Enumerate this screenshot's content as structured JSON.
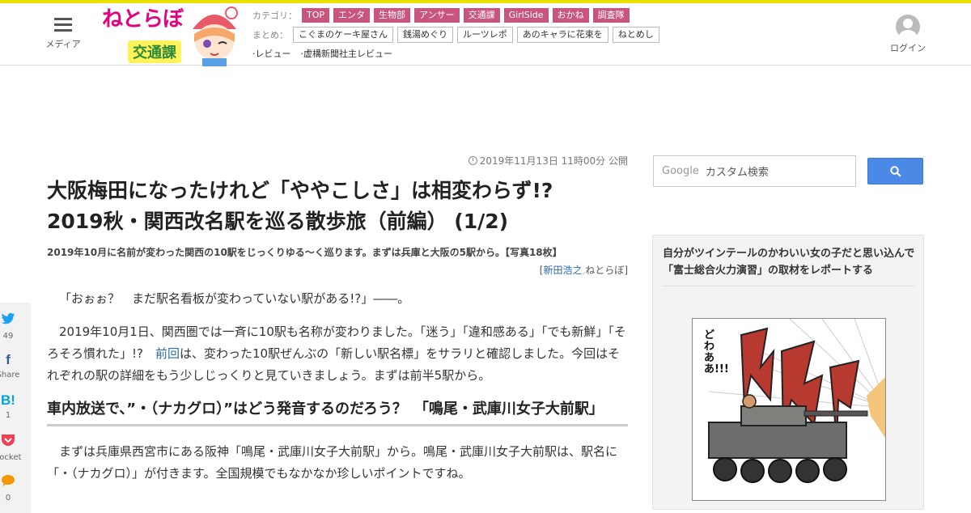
{
  "header": {
    "menu_label": "メディア",
    "logo_title": "ねとらぼ",
    "logo_subtitle": "交通課",
    "category_label": "カテゴリ：",
    "categories": [
      "TOP",
      "エンタ",
      "生物部",
      "アンサー",
      "交通課",
      "GirlSide",
      "おかね",
      "調査隊"
    ],
    "matome_label": "まとめ：",
    "matome": [
      "こぐまのケーキ屋さん",
      "銭湯めぐり",
      "ルーツレポ",
      "あのキャラに花束を",
      "ねとめし"
    ],
    "extras": [
      "·レビュー",
      "·虚構新聞社主レビュー"
    ],
    "login_label": "ログイン"
  },
  "article": {
    "pubdate": "2019年11月13日 11時00分 公開",
    "title_line1": "大阪梅田になったけれど「ややこしさ」は相変わらず!?",
    "title_line2": "2019秋・関西改名駅を巡る散歩旅（前編） (1/2)",
    "subtitle": "2019年10月に名前が変わった関西の10駅をじっくりゆる～く巡ります。まずは兵庫と大阪の5駅から。【写真18枚】",
    "author_open": "[",
    "author": "新田浩之",
    "author_sep": ",",
    "site": "ねとらぼ",
    "author_close": "]",
    "p1": "「おぉぉ？　まだ駅名看板が変わっていない駅がある!?」――。",
    "p2_a": "2019年10月1日、関西圏では一斉に10駅も名称が変わりました。「迷う」「違和感ある」「でも新鮮」「そろそろ慣れた」!?　",
    "p2_link": "前回",
    "p2_b": "は、変わった10駅ぜんぶの「新しい駅名標」をサラリと確認しました。今回はそれぞれの駅の詳細をもう少しじっくりと見ていきましょう。まずは前半5駅から。",
    "h2": "車内放送で、”・（ナカグロ）”はどう発音するのだろう？　「鳴尾・武庫川女子大前駅」",
    "p3": "まずは兵庫県西宮市にある阪神「鳴尾・武庫川女子大前駅」から。鳴尾・武庫川女子大前駅は、駅名に「・（ナカグロ）」が付きます。全国規模でもなかなか珍しいポイントですね。"
  },
  "share": {
    "twitter_icon": "twitter-icon",
    "twitter_count": "49",
    "facebook_label": "Share",
    "hatena_icon": "B!",
    "hatena_count": "1",
    "pocket_label": "Pocket",
    "comment_count": "0"
  },
  "search": {
    "brand": "Google",
    "placeholder": "カスタム検索"
  },
  "sidebar": {
    "card_title": "自分がツインテールのかわいい女の子だと思い込んで「富士総合火力演習」の取材をレポートする",
    "manga_caption": "どわああ!!!"
  },
  "colors": {
    "accent_yellow": "#e8e000",
    "category_pink": "#c7557d",
    "link_blue": "#2a6ab3",
    "search_button": "#4a8ae6"
  }
}
